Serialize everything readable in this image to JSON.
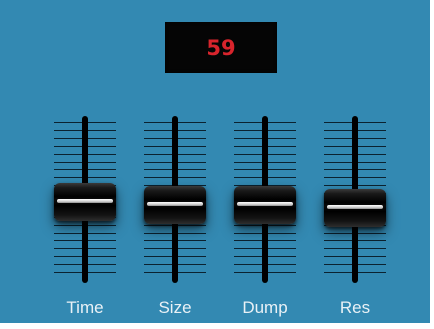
{
  "display": {
    "value": "59"
  },
  "faders": [
    {
      "id": "time",
      "label": "Time",
      "level": 0.52
    },
    {
      "id": "size",
      "label": "Size",
      "level": 0.5
    },
    {
      "id": "dump",
      "label": "Dump",
      "level": 0.5
    },
    {
      "id": "res",
      "label": "Res",
      "level": 0.47
    }
  ],
  "colors": {
    "background": "#3389b2",
    "display_background": "#050505",
    "display_text": "#d8242c",
    "label_text": "#e9f1f6"
  }
}
